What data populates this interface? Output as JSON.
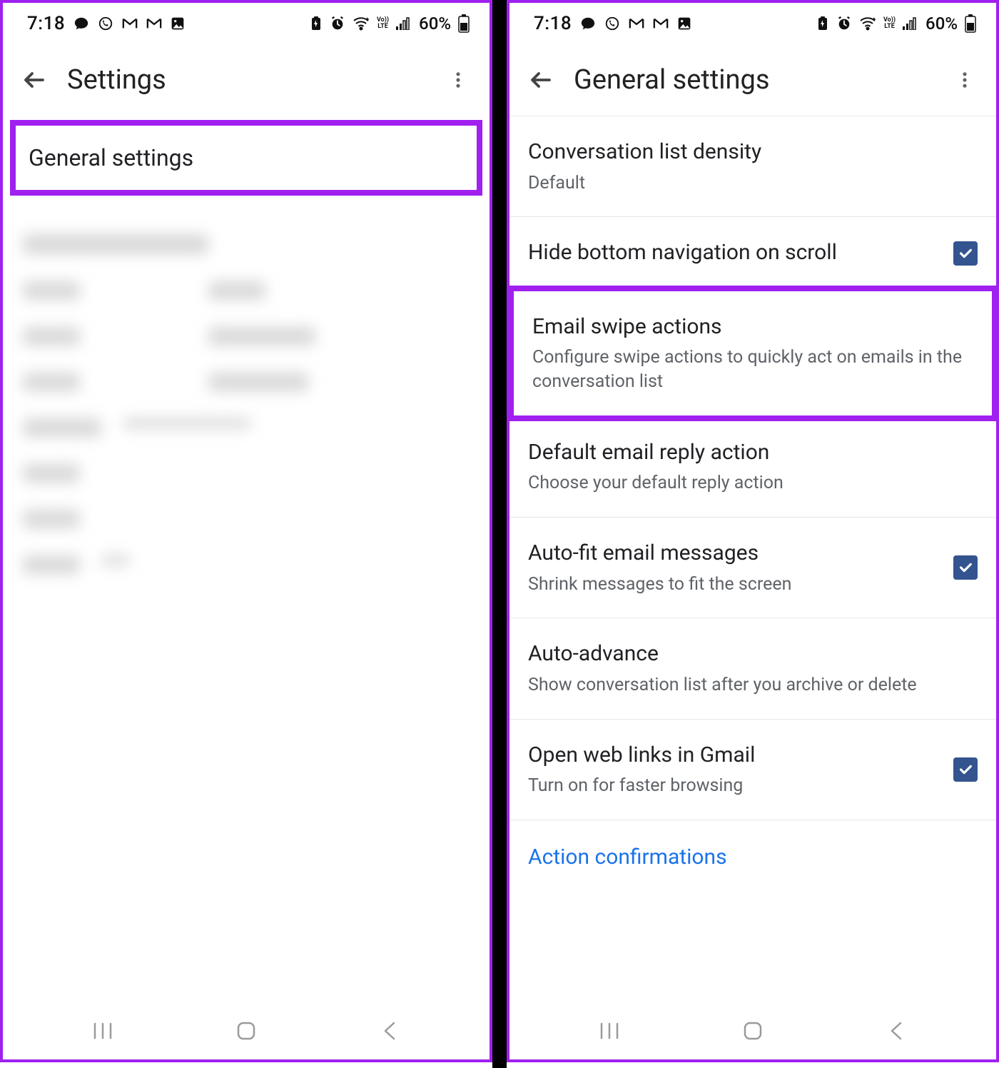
{
  "status": {
    "time": "7:18",
    "battery": "60%",
    "lte_label": "Vo))\nLTE"
  },
  "left": {
    "title": "Settings",
    "general_settings_label": "General settings"
  },
  "right": {
    "title": "General settings",
    "rows": {
      "density": {
        "title": "Conversation list density",
        "sub": "Default"
      },
      "hide_nav": {
        "title": "Hide bottom navigation on scroll"
      },
      "swipe": {
        "title": "Email swipe actions",
        "sub": "Configure swipe actions to quickly act on emails in the conversation list"
      },
      "reply": {
        "title": "Default email reply action",
        "sub": "Choose your default reply action"
      },
      "autofit": {
        "title": "Auto-fit email messages",
        "sub": "Shrink messages to fit the screen"
      },
      "advance": {
        "title": "Auto-advance",
        "sub": "Show conversation list after you archive or delete"
      },
      "weblinks": {
        "title": "Open web links in Gmail",
        "sub": "Turn on for faster browsing"
      },
      "section": "Action confirmations"
    }
  }
}
